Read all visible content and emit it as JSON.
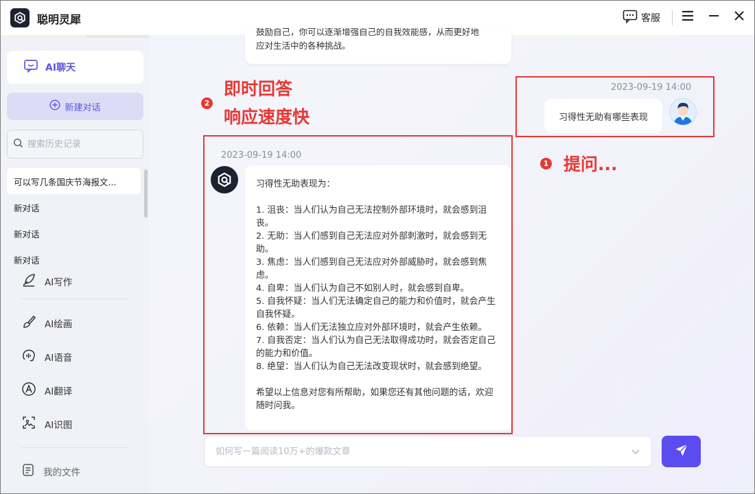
{
  "app": {
    "title": "聪明灵犀"
  },
  "titlebar": {
    "service_label": "客服"
  },
  "sidebar": {
    "active_nav": "AI聊天",
    "new_chat_label": "新建对话",
    "search_placeholder": "搜索历史记录",
    "history": [
      "可以写几条国庆节海报文...",
      "新对话",
      "新对话",
      "新对话"
    ],
    "nav": [
      {
        "label": "AI写作",
        "icon": "feather-pen-icon"
      },
      {
        "label": "AI绘画",
        "icon": "paint-brush-icon"
      },
      {
        "label": "AI语音",
        "icon": "voice-icon"
      },
      {
        "label": "AI翻译",
        "icon": "translate-icon"
      },
      {
        "label": "AI识图",
        "icon": "image-scan-icon"
      }
    ],
    "files_label": "我的文件"
  },
  "chat": {
    "prev_tail": [
      "鼓励自己，你可以逐渐增强自己的自我效能感，从而更好地",
      "应对生活中的各种挑战。"
    ],
    "user_message": {
      "time": "2023-09-19 14:00",
      "text": "习得性无助有哪些表现"
    },
    "bot_message": {
      "time": "2023-09-19 14:00",
      "intro": "习得性无助表现为：",
      "items": [
        "1. 沮丧：当人们认为自己无法控制外部环境时，就会感到沮丧。",
        "2. 无助：当人们感到自己无法应对外部刺激时，就会感到无助。",
        "3. 焦虑：当人们感到自己无法应对外部威胁时，就会感到焦虑。",
        "4. 自卑：当人们认为自己不如别人时，就会感到自卑。",
        "5. 自我怀疑：当人们无法确定自己的能力和价值时，就会产生自我怀疑。",
        "6. 依赖：当人们无法独立应对外部环境时，就会产生依赖。",
        "7. 自我否定：当人们认为自己无法取得成功时，就会否定自己的能力和价值。",
        "8. 绝望：当人们认为自己无法改变现状时，就会感到绝望。"
      ],
      "closing": "希望以上信息对您有所帮助，如果您还有其他问题的话，欢迎随时问我。"
    },
    "input_placeholder": "如何写一篇阅读10万+的爆款文章"
  },
  "annotations": {
    "one": {
      "num": "1",
      "text": "提问..."
    },
    "two": {
      "num": "2",
      "line1": "即时回答",
      "line2": "响应速度快"
    }
  },
  "colors": {
    "accent": "#5b4cf0",
    "annotation": "#e53935",
    "logo_bg": "#1b2230"
  }
}
